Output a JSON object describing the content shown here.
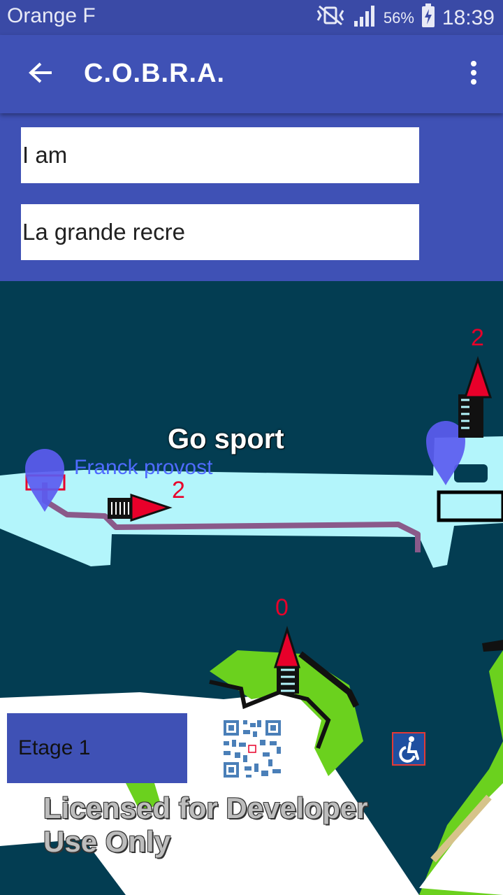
{
  "status_bar": {
    "carrier": "Orange F",
    "battery": "56%",
    "time": "18:39"
  },
  "app_bar": {
    "title": "C.O.B.R.A."
  },
  "search": {
    "from_value": "I am",
    "to_value": "La grande recre"
  },
  "map": {
    "store_label_go_sport": "Go sport",
    "store_label_franck": "Franck provost",
    "floor_label_stairs_right": "2",
    "floor_label_stairs_left": "2",
    "floor_label_stairs_bottom": "0"
  },
  "floor_button": {
    "label": "Etage 1"
  },
  "watermark": {
    "line1": "Licensed for Developer",
    "line2": "Use Only"
  },
  "colors": {
    "primary": "#3f51b5",
    "status_bar": "#3a4aa6",
    "map_bg": "#033d52",
    "corridor": "#b3f5fb",
    "route": "#8a5a8a",
    "marker": "#5b5bf0",
    "arrow": "#e8002a",
    "green_area": "#6bd11e"
  }
}
